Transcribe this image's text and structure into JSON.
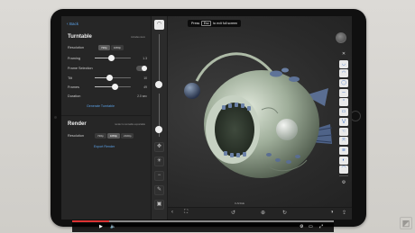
{
  "panel": {
    "back_label": "Back",
    "turntable": {
      "title": "Turntable",
      "note": "includes stem",
      "resolution_label": "Resolution",
      "resolution_options": [
        "720p",
        "1080p"
      ],
      "resolution_selected": "720p",
      "framing_label": "Framing",
      "framing_value": "1.3",
      "framing_level": 0.45,
      "frame_selection_label": "Frame Selection",
      "tilt_label": "Tilt",
      "tilt_value": "10",
      "tilt_level": 0.4,
      "frames_label": "Frames",
      "frames_value": "49",
      "frames_level": 0.55,
      "duration_label": "Duration",
      "duration_value": "2.0 sec",
      "generate_label": "Generate Turntable"
    },
    "render": {
      "title": "Render",
      "note": "render to tunnable exportable",
      "resolution_label": "Resolution",
      "resolution_options": [
        "720p",
        "1080p",
        "2160p"
      ],
      "resolution_selected": "1080p",
      "export_label": "Export Render"
    }
  },
  "toast": {
    "prefix": "Press",
    "key": "Esc",
    "suffix": "to exit full screen"
  },
  "viewport": {
    "object_name": "0.ANGE"
  },
  "colors": {
    "accent": "#5aa0e6",
    "toolbar_icon": "#3a6fc4",
    "progress": "#dd3333"
  },
  "icons": {
    "tool_column": [
      "turntable-icon",
      "move-icon",
      "lightbulb-icon",
      "minus-icon",
      "pen-icon",
      "camera-icon"
    ],
    "right_toolbar": [
      "close-x-icon",
      "brush-standard-icon",
      "brush-clay-icon",
      "brush-inflate-icon",
      "brush-smooth-icon",
      "brush-pinch-icon",
      "brush-flatten-icon",
      "brush-crease-icon",
      "brush-grab-icon",
      "brush-move-icon",
      "brush-layer-icon",
      "brush-mask-icon",
      "brush-trim-icon",
      "settings-icon"
    ],
    "bottom_bar": [
      "collapse-left-icon",
      "undo-icon",
      "redo-icon",
      "render-sphere-icon"
    ]
  },
  "video": {
    "progress": 0.14
  }
}
